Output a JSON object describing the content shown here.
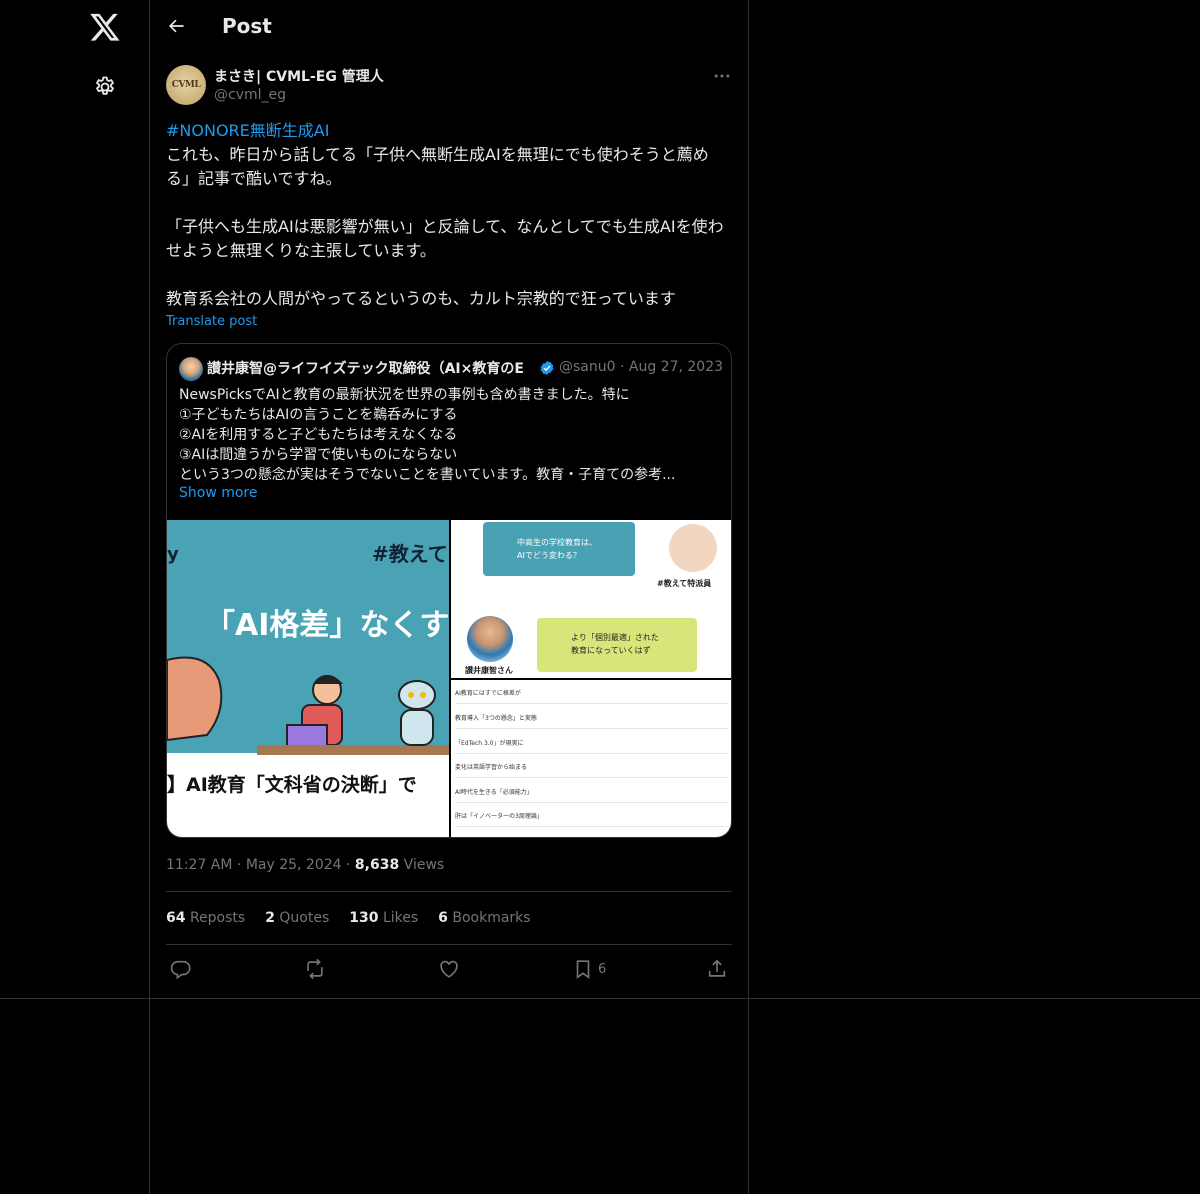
{
  "nav": {
    "logo_icon": "x-logo-icon",
    "settings_icon": "gear-icon"
  },
  "header": {
    "title": "Post",
    "back_icon": "arrow-left-icon"
  },
  "author": {
    "name": "まさき| CVML-EG 管理人",
    "handle": "@cvml_eg",
    "avatar_text": "CVML"
  },
  "post": {
    "hashtag": "#NONORE無断生成AI",
    "line1": "これも、昨日から話してる「子供へ無断生成AIを無理にでも使わそうと薦める」記事で酷いですね。",
    "para2": "「子供へも生成AIは悪影響が無い」と反論して、なんとしてでも生成AIを使わせようと無理くりな主張しています。",
    "para3": "教育系会社の人間がやってるというのも、カルト宗教的で狂っています",
    "translate": "Translate post"
  },
  "quote": {
    "name": "讃井康智@ライフイズテック取締役（AI×教育のE",
    "handle": "@sanu0",
    "sep": "·",
    "date": "Aug 27, 2023",
    "lines": [
      "NewsPicksでAIと教育の最新状況を世界の事例も含め書きました。特に",
      "①子どもたちはAIの言うことを鵜呑みにする",
      "②AIを利用すると子どもたちは考えなくなる",
      "③AIは間違うから学習で使いものにならない",
      "という3つの懸念が実はそうでないことを書いています。教育・子育ての参考..."
    ],
    "show_more": "Show more",
    "img_left": {
      "tag": "#教えて",
      "y": "y",
      "headline": "「AI格差」なくす",
      "caption": "】AI教育「文科省の決断」で"
    },
    "img_tr": {
      "bubble1a": "中高生の学校教育は、",
      "bubble1b": "AIでどう変わる？",
      "tag": "#教えて特派員",
      "bubble2a": "より「個別最適」された",
      "bubble2b": "教育になっていくはず",
      "person": "讃井康智さん"
    },
    "img_br": [
      "AI教育にはすでに格差が",
      "教育導入「3つの懸念」と実態",
      "「EdTech 3.0」が現実に",
      "変化は英語学習から始まる",
      "AI時代を生きる「必須能力」",
      "肝は「イノベーターの3周理論」"
    ]
  },
  "meta": {
    "time": "11:27 AM",
    "dot": "·",
    "date": "May 25, 2024",
    "views_count": "8,638",
    "views_label": "Views"
  },
  "stats": {
    "reposts_count": "64",
    "reposts_label": "Reposts",
    "quotes_count": "2",
    "quotes_label": "Quotes",
    "likes_count": "130",
    "likes_label": "Likes",
    "bookmarks_count": "6",
    "bookmarks_label": "Bookmarks"
  },
  "actions": {
    "bookmark_count": "6"
  },
  "colors": {
    "accent": "#1d9bf0",
    "text": "#e7e9ea",
    "muted": "#71767b",
    "border": "#2f3336"
  }
}
